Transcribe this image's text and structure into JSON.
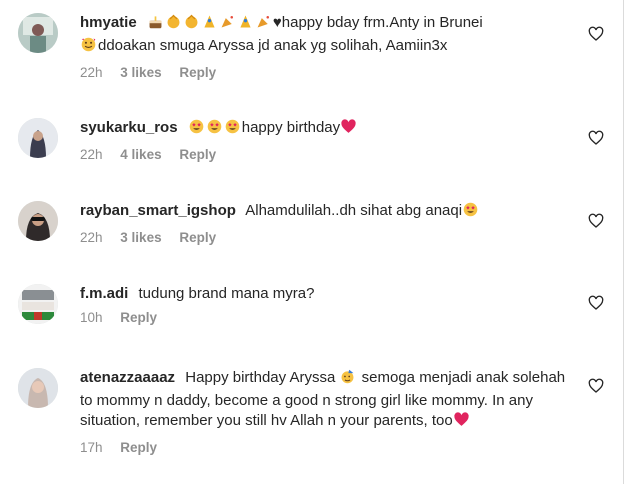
{
  "comments": [
    {
      "username": "hmyatie",
      "text_before_emoji": "",
      "text": "♥happy bday frm.Anty in Brunei",
      "text_line2": "ddoakan smuga Aryssa jd anak yg solihah, Aamiin3x",
      "time": "22h",
      "likes": "3 likes",
      "reply": "Reply"
    },
    {
      "username": "syukarku_ros",
      "text": "happy birthday",
      "time": "22h",
      "likes": "4 likes",
      "reply": "Reply"
    },
    {
      "username": "rayban_smart_igshop",
      "text": "Alhamdulilah..dh sihat abg anaqi",
      "time": "22h",
      "likes": "3 likes",
      "reply": "Reply"
    },
    {
      "username": "f.m.adi",
      "text": "tudung brand mana myra?",
      "time": "10h",
      "reply": "Reply"
    },
    {
      "username": "atenazzaaaaz",
      "text_a": "Happy birthday Aryssa",
      "text_b": "semoga menjadi anak solehah to mommy n daddy, become a good n strong girl like mommy. In any situation, remember you still hv Allah n your parents, too",
      "time": "17h",
      "reply": "Reply"
    }
  ],
  "colors": {
    "heart_red": "#e0245e",
    "meta_gray": "#8e8e8e",
    "text": "#262626"
  },
  "icons": [
    "heart-outline-icon",
    "birthday-cake-emoji",
    "clapping-hands-emoji",
    "party-popper-emoji",
    "heart-eyes-emoji",
    "red-heart-emoji",
    "smiling-hearts-emoji",
    "partying-face-emoji"
  ]
}
